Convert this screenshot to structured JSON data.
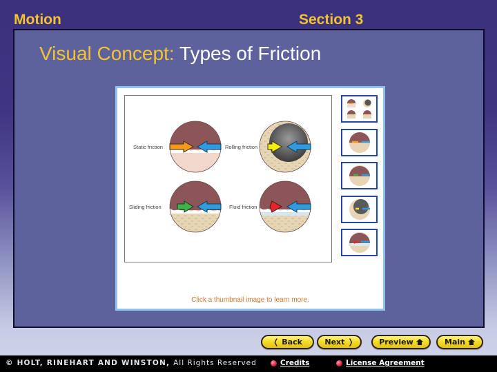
{
  "header": {
    "chapter": "Motion",
    "section": "Section 3"
  },
  "slide": {
    "title_label": "Visual Concept:",
    "title_text": "Types of Friction",
    "diagram": {
      "labels": [
        "Static friction",
        "Rolling friction",
        "Sliding friction",
        "Fluid friction"
      ],
      "arrow_colors": {
        "static": "#f39a1e",
        "rolling": "#f5ef12",
        "sliding": "#3fb34a",
        "fluid": "#e3262b",
        "opposing": "#2f9be0"
      }
    },
    "thumbnails": [
      {
        "name": "all-types"
      },
      {
        "name": "static"
      },
      {
        "name": "sliding"
      },
      {
        "name": "rolling"
      },
      {
        "name": "fluid"
      }
    ],
    "hint": "Click a thumbnail image to learn more."
  },
  "nav": {
    "back": "Back",
    "next": "Next",
    "preview": "Preview",
    "main": "Main"
  },
  "footer": {
    "copyright_symbol": "©",
    "publisher": "HOLT, RINEHART AND WINSTON,",
    "rights": "All Rights Reserved",
    "credits": "Credits",
    "license": "License Agreement"
  },
  "colors": {
    "accent_yellow": "#f2c232",
    "panel": "#5d629d",
    "thumb_border": "#2446a8",
    "hint": "#d9762a"
  }
}
